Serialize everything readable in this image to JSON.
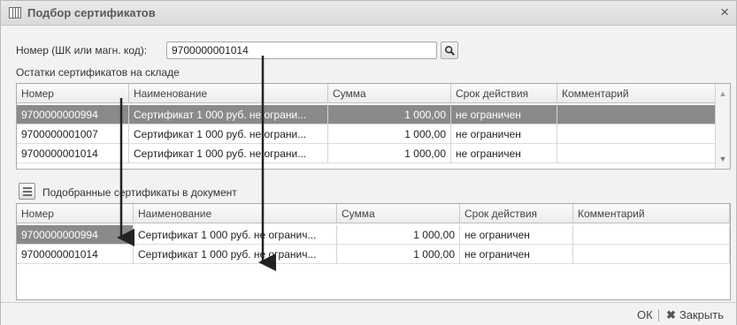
{
  "window": {
    "title": "Подбор сертификатов",
    "close_glyph": "×"
  },
  "search": {
    "label": "Номер (ШК или магн. код):",
    "value": "9700000001014"
  },
  "stock": {
    "title": "Остатки сертификатов на складе",
    "columns": [
      "Номер",
      "Наименование",
      "Сумма",
      "Срок действия",
      "Комментарий"
    ],
    "rows": [
      {
        "number": "9700000000994",
        "name": "Сертификат 1 000 руб. не ограни...",
        "sum": "1 000,00",
        "term": "не ограничен",
        "comment": ""
      },
      {
        "number": "9700000001007",
        "name": "Сертификат 1 000 руб. не ограни...",
        "sum": "1 000,00",
        "term": "не ограничен",
        "comment": ""
      },
      {
        "number": "9700000001014",
        "name": "Сертификат 1 000 руб. не ограни...",
        "sum": "1 000,00",
        "term": "не ограничен",
        "comment": ""
      }
    ]
  },
  "picked": {
    "title": "Подобранные сертификаты в документ",
    "columns": [
      "Номер",
      "Наименование",
      "Сумма",
      "Срок действия",
      "Комментарий"
    ],
    "rows": [
      {
        "number": "9700000000994",
        "name": "Сертификат 1 000 руб. не огранич...",
        "sum": "1 000,00",
        "term": "не ограничен",
        "comment": ""
      },
      {
        "number": "9700000001014",
        "name": "Сертификат 1 000 руб. не огранич...",
        "sum": "1 000,00",
        "term": "не ограничен",
        "comment": ""
      }
    ]
  },
  "footer": {
    "ok": "ОК",
    "close": "Закрыть",
    "close_glyph": "✖"
  }
}
